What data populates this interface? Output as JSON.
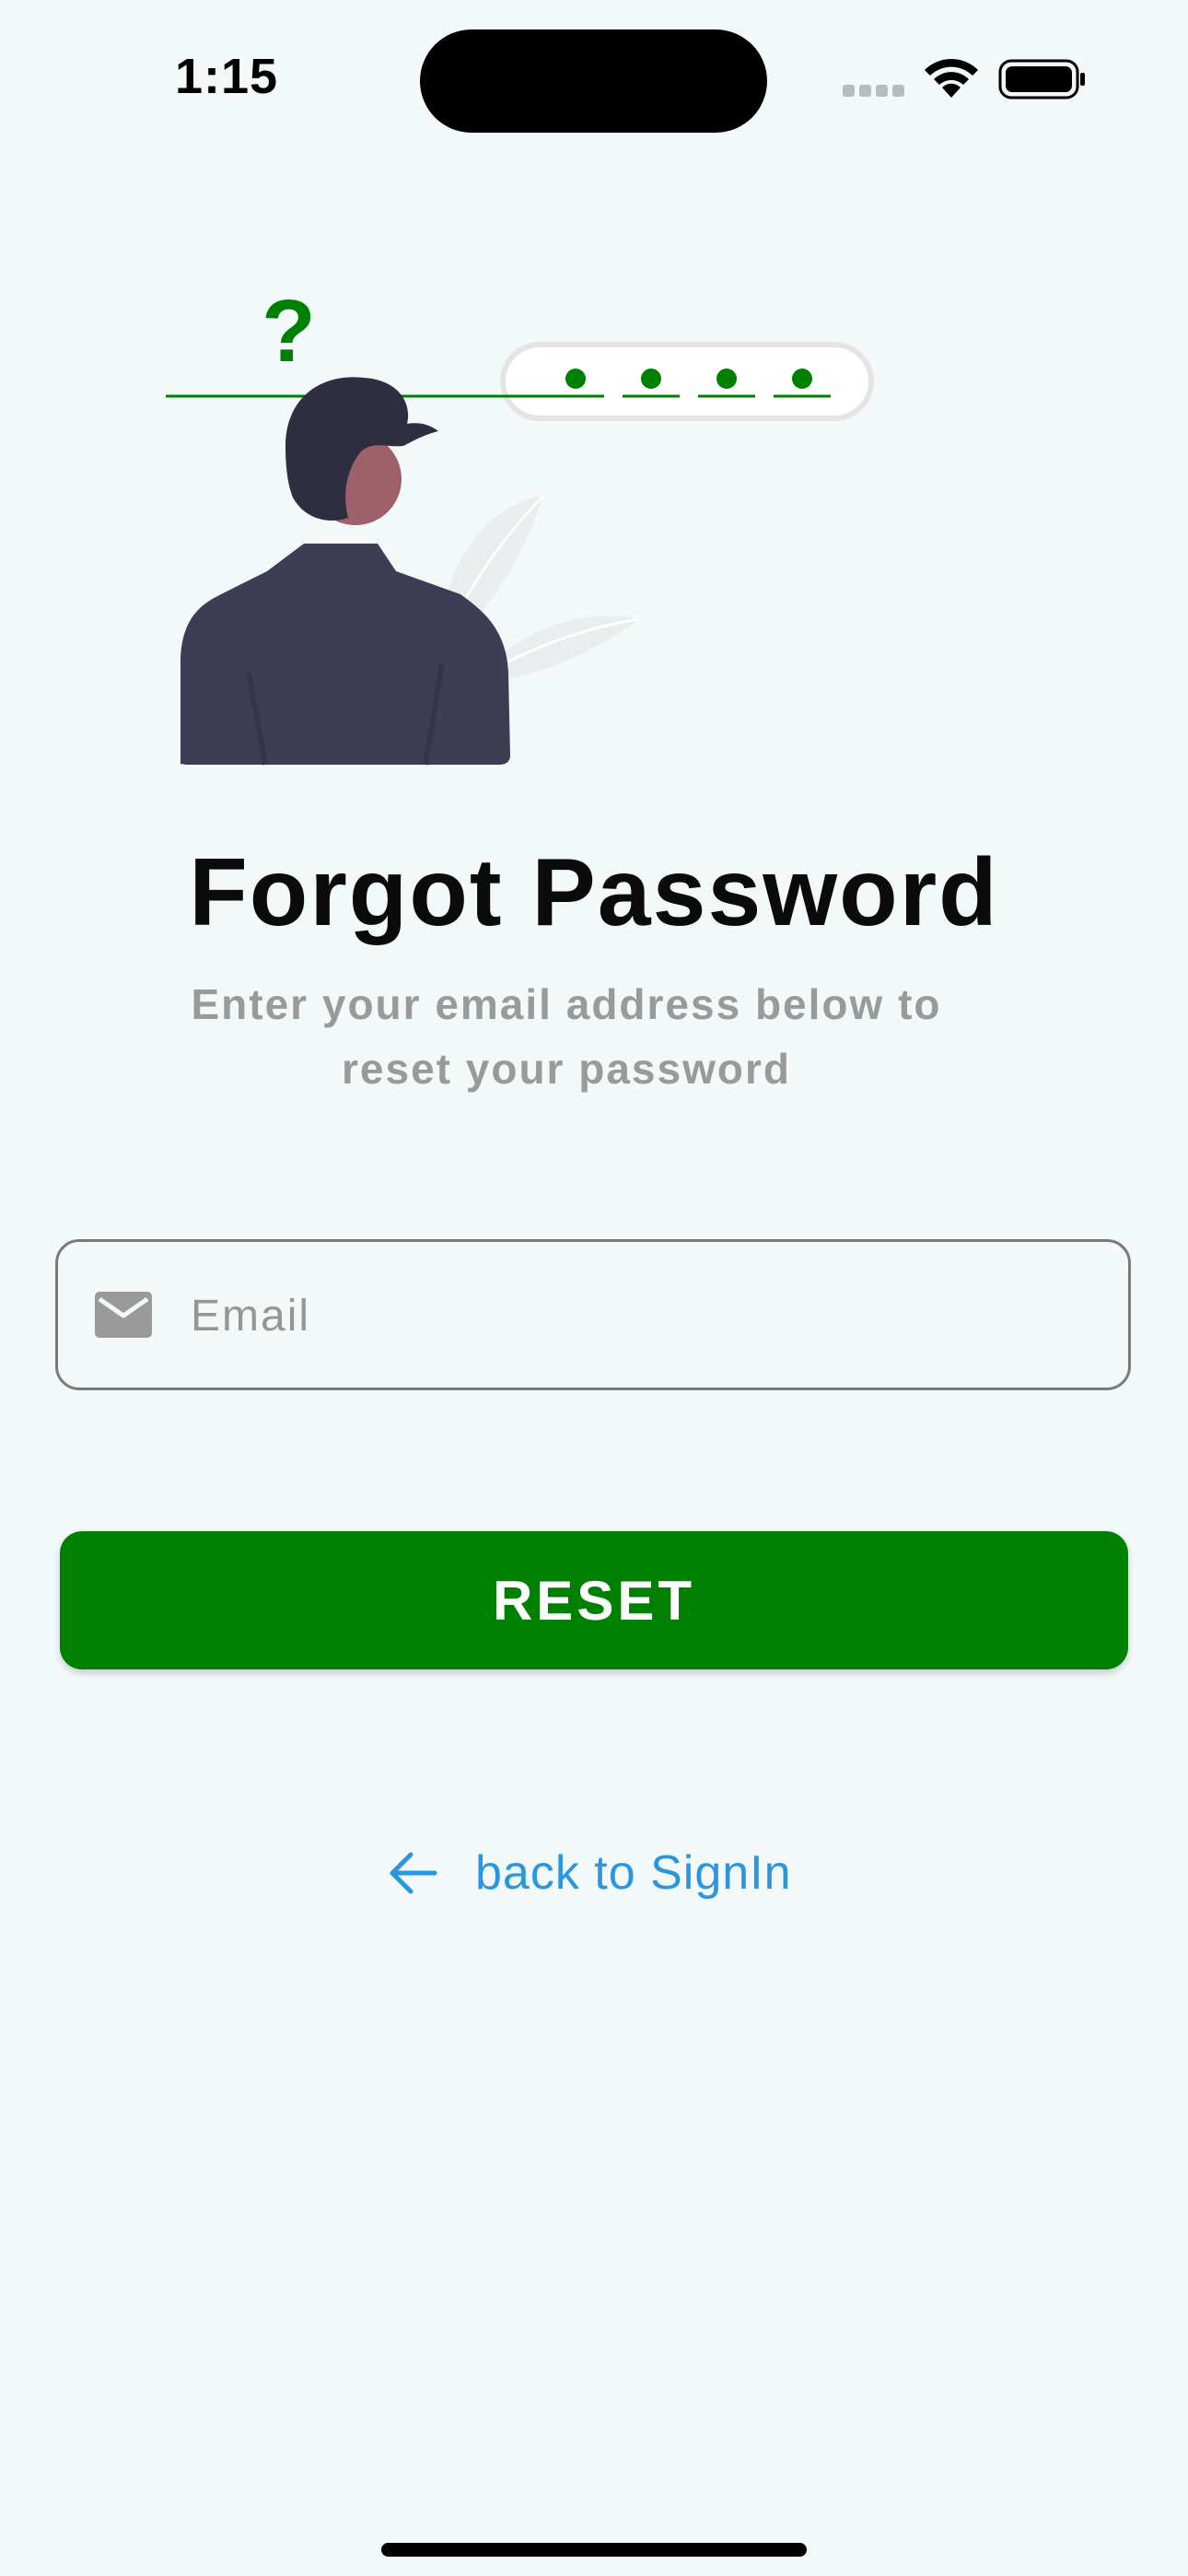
{
  "status_bar": {
    "time": "1:15",
    "icons": [
      "cellular-signal-icon",
      "wifi-icon",
      "battery-icon"
    ]
  },
  "illustration": {
    "question_mark": "?",
    "password_dots": 4,
    "accent_color": "#008000"
  },
  "page": {
    "title": "Forgot Password",
    "subtitle": "Enter your email address below to reset your password"
  },
  "email_field": {
    "icon": "mail-icon",
    "placeholder": "Email",
    "value": ""
  },
  "reset_button": {
    "label": "RESET",
    "color": "#008000"
  },
  "back_link": {
    "icon": "arrow-left-icon",
    "label": "back to SignIn",
    "color": "#2a95e0"
  },
  "colors": {
    "background": "#f3f9f9",
    "title": "#0b0b0b",
    "subtitle": "#9a9a9a"
  }
}
